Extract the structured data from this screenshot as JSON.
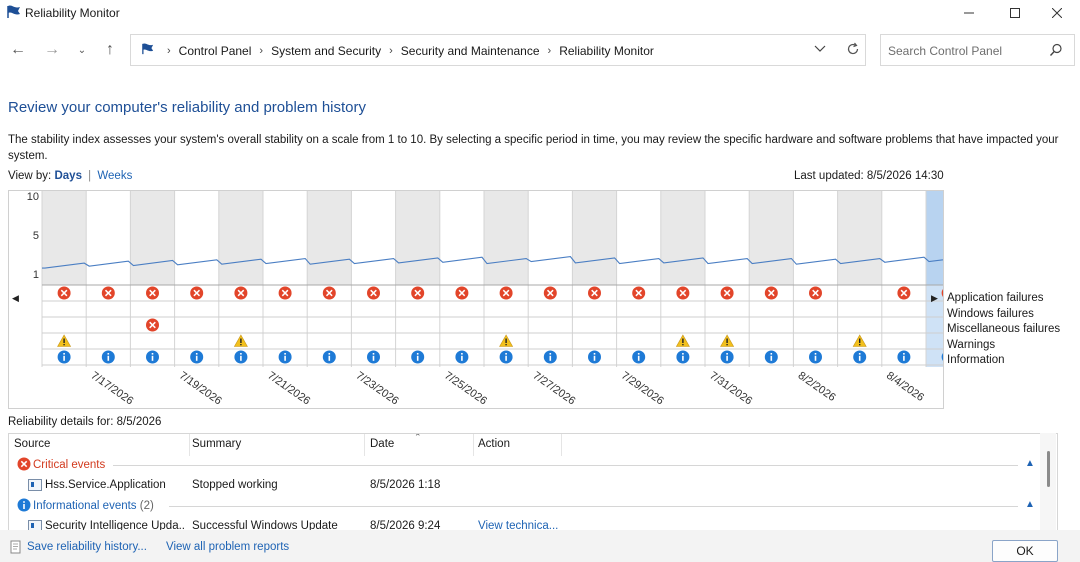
{
  "window": {
    "title": "Reliability Monitor"
  },
  "breadcrumb": [
    "Control Panel",
    "System and Security",
    "Security and Maintenance",
    "Reliability Monitor"
  ],
  "search": {
    "placeholder": "Search Control Panel"
  },
  "heading": "Review your computer's reliability and problem history",
  "description": "The stability index assesses your system's overall stability on a scale from 1 to 10. By selecting a specific period in time, you may review the specific hardware and software problems that have impacted your system.",
  "view_by": {
    "label": "View by:",
    "days": "Days",
    "separator": "|",
    "weeks": "Weeks"
  },
  "last_updated": "Last updated: 8/5/2026 14:30",
  "chart_data": {
    "type": "line",
    "ylim": [
      0,
      10
    ],
    "y_ticks": [
      "10",
      "5",
      "1"
    ],
    "date_labels": [
      "7/17/2026",
      "7/19/2026",
      "7/21/2026",
      "7/23/2026",
      "7/25/2026",
      "7/27/2026",
      "7/29/2026",
      "7/31/2026",
      "8/2/2026",
      "8/4/2026"
    ],
    "dates": [
      "7/16/2026",
      "7/17/2026",
      "7/18/2026",
      "7/19/2026",
      "7/20/2026",
      "7/21/2026",
      "7/22/2026",
      "7/23/2026",
      "7/24/2026",
      "7/25/2026",
      "7/26/2026",
      "7/27/2026",
      "7/28/2026",
      "7/29/2026",
      "7/30/2026",
      "7/31/2026",
      "8/1/2026",
      "8/2/2026",
      "8/3/2026",
      "8/4/2026",
      "8/5/2026"
    ],
    "stability_index": [
      2.6,
      2.9,
      3.0,
      3.1,
      3.2,
      3.3,
      3.2,
      3.3,
      3.4,
      3.5,
      3.3,
      3.6,
      3.4,
      3.3,
      3.4,
      3.3,
      3.3,
      3.2,
      3.3,
      3.5,
      3.6
    ],
    "selected_day": "8/5/2026",
    "legend": [
      "Application failures",
      "Windows failures",
      "Miscellaneous failures",
      "Warnings",
      "Information"
    ],
    "application_failures": [
      1,
      1,
      1,
      1,
      1,
      1,
      1,
      1,
      1,
      1,
      1,
      1,
      1,
      1,
      1,
      1,
      1,
      1,
      0,
      1,
      0
    ],
    "windows_failures": [
      0,
      0,
      0,
      0,
      0,
      0,
      0,
      0,
      0,
      0,
      0,
      0,
      0,
      0,
      0,
      0,
      0,
      0,
      0,
      0,
      0
    ],
    "miscellaneous_failures": [
      0,
      0,
      1,
      0,
      0,
      0,
      0,
      0,
      0,
      0,
      0,
      0,
      0,
      0,
      0,
      0,
      0,
      0,
      0,
      0,
      0
    ],
    "warnings": [
      1,
      0,
      0,
      0,
      1,
      0,
      0,
      0,
      0,
      0,
      1,
      0,
      0,
      0,
      1,
      1,
      0,
      0,
      1,
      0,
      0
    ],
    "information": [
      1,
      1,
      1,
      1,
      1,
      1,
      1,
      1,
      1,
      1,
      1,
      1,
      1,
      1,
      1,
      1,
      1,
      1,
      1,
      1,
      0
    ]
  },
  "details": {
    "title": "Reliability details for: 8/5/2026",
    "columns": [
      "Source",
      "Summary",
      "Date",
      "Action"
    ],
    "critical_group": "Critical events",
    "critical_rows": [
      {
        "source": "Hss.Service.Application",
        "summary": "Stopped working",
        "date": "8/5/2026 1:18",
        "action": ""
      }
    ],
    "info_group": "Informational events",
    "info_count": "(2)",
    "info_rows": [
      {
        "source": "Security Intelligence Upda...",
        "summary": "Successful Windows Update",
        "date": "8/5/2026 9:24",
        "action": "View technica..."
      }
    ]
  },
  "footer": {
    "save_link": "Save reliability history...",
    "reports_link": "View all problem reports",
    "ok": "OK"
  },
  "colors": {
    "line": "#4a7ec3",
    "selection": "#b8d3f0",
    "critical": "#e2452a",
    "warning": "#f2c01c",
    "info": "#1e7ad6",
    "link": "#1e63b4"
  }
}
